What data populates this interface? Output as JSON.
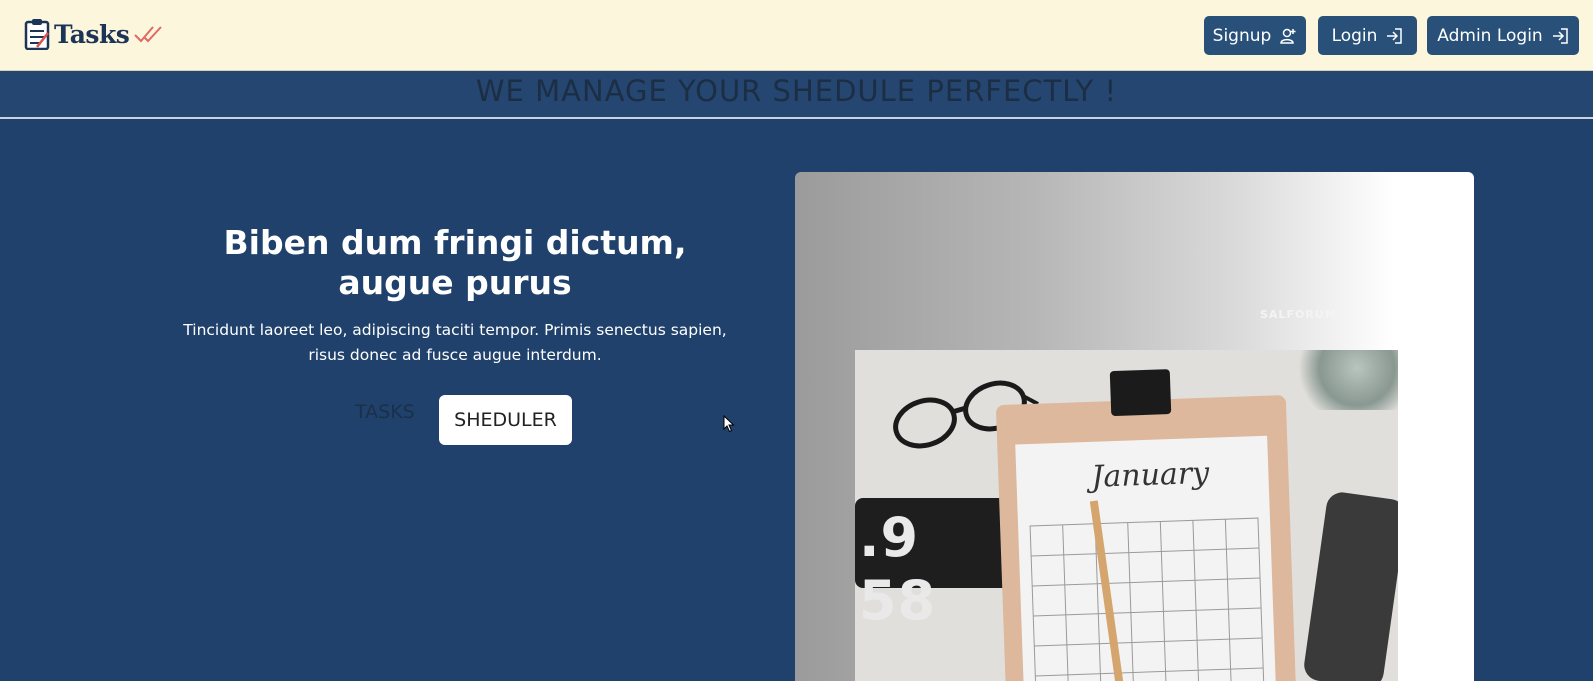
{
  "navbar": {
    "brand": "Tasks",
    "buttons": {
      "signup": "Signup",
      "login": "Login",
      "admin_login": "Admin Login"
    }
  },
  "hero": {
    "tagline": "WE MANAGE YOUR SHEDULE PERFECTLY !",
    "title": "Biben dum fringi dictum, augue purus",
    "text": "Tincidunt laoreet leo, adipiscing taciti tempor. Primis senectus sapien, risus donec ad fusce augue interdum.",
    "tabs": {
      "tasks": "TASKS",
      "sheduler": "SHEDULER"
    }
  },
  "image_card": {
    "caption": "SALFORUM",
    "calendar_month": "January",
    "clock_display": ".9 58"
  },
  "colors": {
    "navbar_bg": "#fcf6dc",
    "hero_bg": "#1f416b",
    "button_bg": "#285079"
  }
}
